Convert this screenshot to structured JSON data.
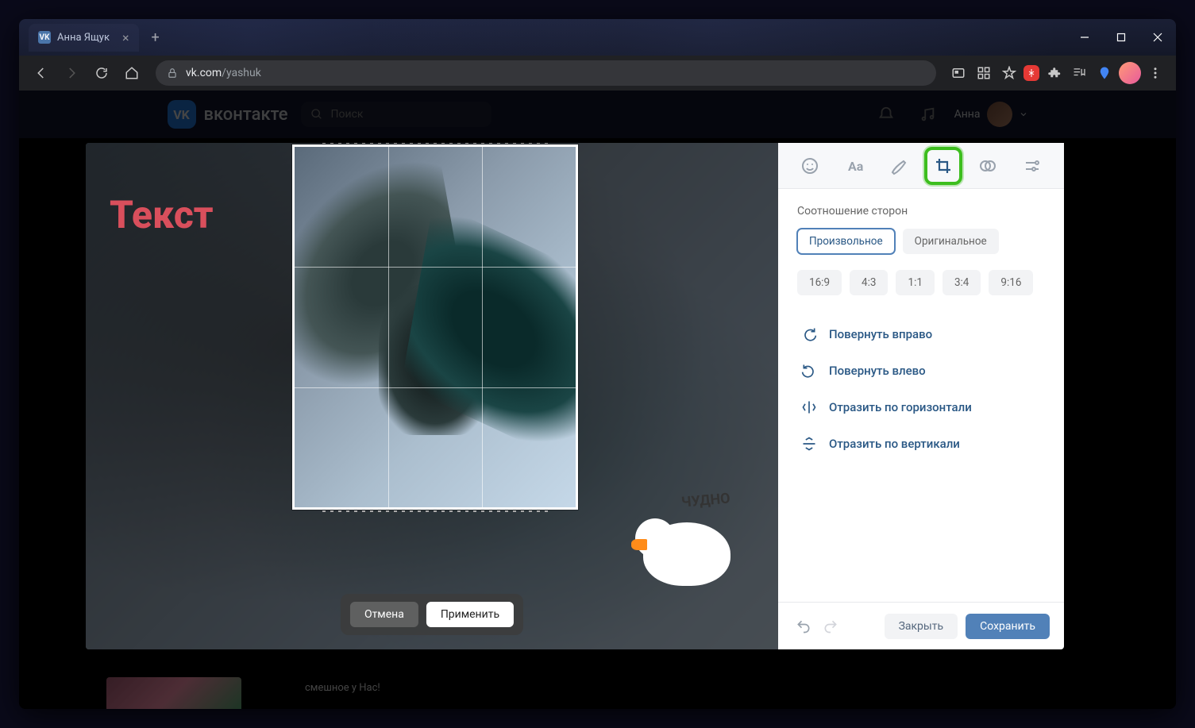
{
  "browser": {
    "tab_title": "Анна Ящук",
    "url_domain": "vk.com",
    "url_path": "/yashuk"
  },
  "vk_header": {
    "logo_text": "вконтакте",
    "search_placeholder": "Поиск",
    "username": "Анна"
  },
  "canvas": {
    "text_overlay": "Текст",
    "sticker_text": "ЧУДНО",
    "cancel": "Отмена",
    "apply": "Применить"
  },
  "sidebar": {
    "aspect_title": "Соотношение сторон",
    "ratio_free": "Произвольное",
    "ratio_original": "Оригинальное",
    "ratios": [
      "16:9",
      "4:3",
      "1:1",
      "3:4",
      "9:16"
    ],
    "actions": {
      "rotate_right": "Повернуть вправо",
      "rotate_left": "Повернуть влево",
      "flip_h": "Отразить по горизонтали",
      "flip_v": "Отразить по вертикали"
    },
    "close": "Закрыть",
    "save": "Сохранить"
  },
  "peek": {
    "text": "смешное у Нас!"
  }
}
